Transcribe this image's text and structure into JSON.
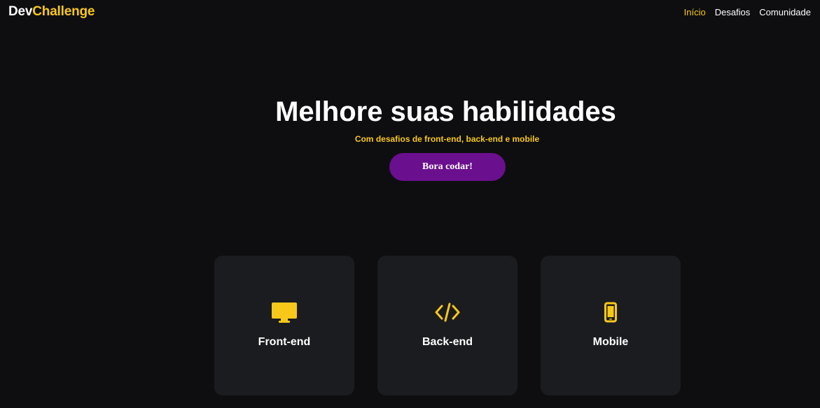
{
  "header": {
    "logo": {
      "part1": "Dev",
      "part2": "Challenge"
    },
    "nav": [
      {
        "label": "Início",
        "active": true
      },
      {
        "label": "Desafios",
        "active": false
      },
      {
        "label": "Comunidade",
        "active": false
      }
    ]
  },
  "hero": {
    "title": "Melhore suas habilidades",
    "subtitle": "Com desafios de front-end, back-end e mobile",
    "cta_label": "Bora codar!"
  },
  "cards": [
    {
      "label": "Front-end",
      "icon": "monitor-icon"
    },
    {
      "label": "Back-end",
      "icon": "code-icon"
    },
    {
      "label": "Mobile",
      "icon": "smartphone-icon"
    }
  ],
  "colors": {
    "background": "#0e0e10",
    "accent": "#f7c81a",
    "button": "#6a0f8e",
    "card": "#1b1c1f",
    "text": "#ffffff"
  }
}
